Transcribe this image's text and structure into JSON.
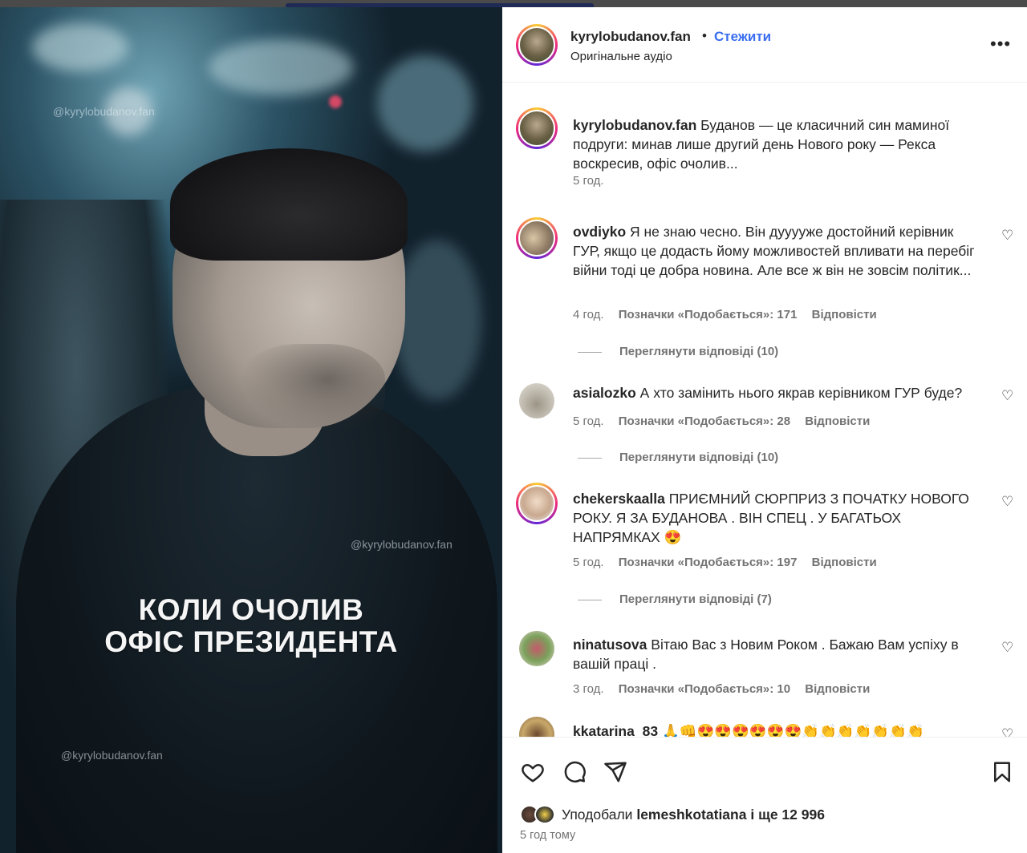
{
  "media": {
    "watermark": "@kyrylobudanov.fan",
    "overlay_line1": "КОЛИ ОЧОЛИВ",
    "overlay_line2": "ОФІС ПРЕЗИДЕНТА"
  },
  "header": {
    "username": "kyrylobudanov.fan",
    "separator": "•",
    "follow_label": "Стежити",
    "audio_label": "Оригінальне аудіо",
    "more_icon": "more-horizontal-icon"
  },
  "caption": {
    "username": "kyrylobudanov.fan",
    "text": "Буданов — це класичний син маминої подруги: минав лише другий день Нового року — Рекса воскресив, офіс очолив...",
    "time": "5 год."
  },
  "comments": [
    {
      "username": "ovdiyko",
      "text": "Я не знаю чесно. Він дууууже достойний керівник ГУР, якщо це додасть йому можливостей впливати на перебіг війни тоді це добра новина. Але все ж він не зовсім політик...",
      "time": "4 год.",
      "likes": "Позначки «Подобається»: 171",
      "reply_label": "Відповісти",
      "view_replies": "Переглянути відповіді (10)"
    },
    {
      "username": "asialozko",
      "text": "А хто замінить нього якрав керівником ГУР буде?",
      "time": "5 год.",
      "likes": "Позначки «Подобається»: 28",
      "reply_label": "Відповісти",
      "view_replies": "Переглянути відповіді (10)"
    },
    {
      "username": "chekerskaalla",
      "text": "ПРИЄМНИЙ СЮРПРИЗ З ПОЧАТКУ НОВОГО РОКУ. Я ЗА БУДАНОВА . ВІН СПЕЦ . У БАГАТЬОХ НАПРЯМКАХ 😍",
      "time": "5 год.",
      "likes": "Позначки «Подобається»: 197",
      "reply_label": "Відповісти",
      "view_replies": "Переглянути відповіді (7)"
    },
    {
      "username": "ninatusova",
      "text": "Вітаю Вас з Новим Роком . Бажаю Вам успіху в вашій праці .",
      "time": "3 год.",
      "likes": "Позначки «Подобається»: 10",
      "reply_label": "Відповісти"
    },
    {
      "username": "kkatarina_83",
      "text": "🙏👊😍😍😍😍😍😍👏👏👏👏👏👏👏"
    }
  ],
  "actions": {
    "like_icon": "heart-outline-icon",
    "comment_icon": "comment-icon",
    "share_icon": "paper-plane-icon",
    "save_icon": "bookmark-icon"
  },
  "likes_summary": {
    "prefix": "Уподобали",
    "user": "lemeshkotatiana",
    "suffix": "і ще 12 996"
  },
  "posted_ago": "5 год тому",
  "colors": {
    "follow_blue": "#3a6ef0",
    "muted_text": "#737373",
    "text": "#262626"
  }
}
